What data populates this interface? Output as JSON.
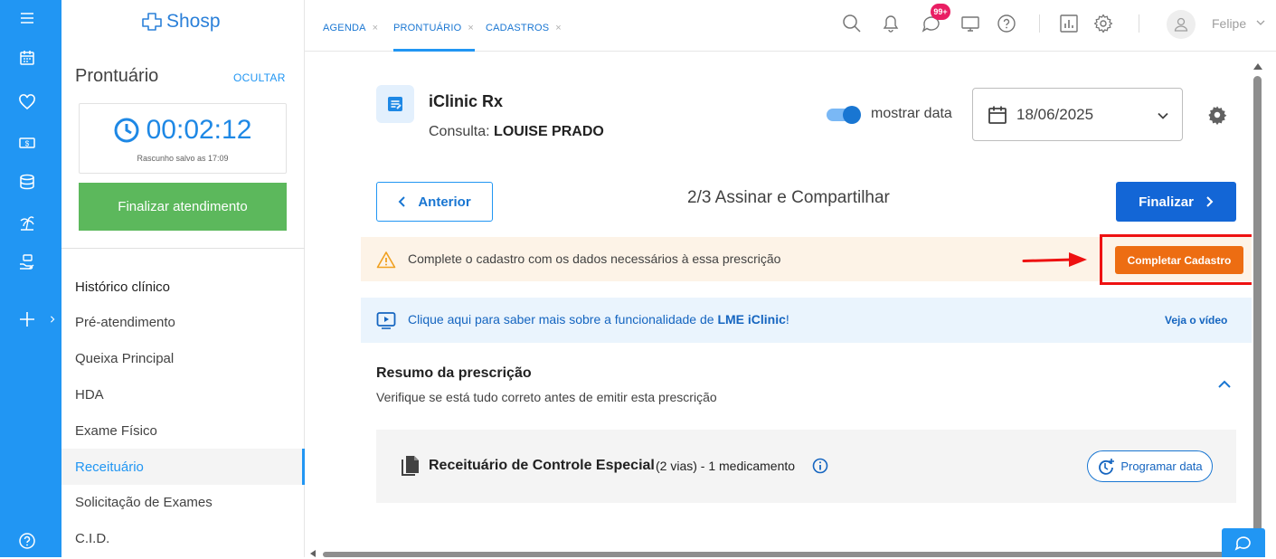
{
  "logo": {
    "text": "Shosp"
  },
  "rail": {
    "icons": [
      "menu-icon",
      "calendar-icon",
      "heart-icon",
      "money-icon",
      "database-icon",
      "palm-tree-icon",
      "hand-money-icon",
      "plus-icon",
      "help-circle-icon"
    ]
  },
  "sidebar": {
    "title": "Prontuário",
    "hide_label": "OCULTAR",
    "timer": "00:02:12",
    "draft_saved": "Rascunho salvo as 17:09",
    "finish_label": "Finalizar atendimento",
    "section_title": "Histórico clínico",
    "items": [
      {
        "label": "Pré-atendimento",
        "active": false
      },
      {
        "label": "Queixa Principal",
        "active": false
      },
      {
        "label": "HDA",
        "active": false
      },
      {
        "label": "Exame Físico",
        "active": false
      },
      {
        "label": "Receituário",
        "active": true
      },
      {
        "label": "Solicitação de Exames",
        "active": false
      },
      {
        "label": "C.I.D.",
        "active": false
      }
    ]
  },
  "tabs": [
    {
      "label": "AGENDA",
      "close": "×"
    },
    {
      "label": "PRONTUÁRIO",
      "close": "×"
    },
    {
      "label": "CADASTROS",
      "close": "×"
    }
  ],
  "topbar": {
    "notification_badge": "99+",
    "user_name": "Felipe"
  },
  "header": {
    "app_name": "iClinic Rx",
    "consult_prefix": "Consulta:",
    "patient_name": "LOUISE PRADO",
    "show_date_label": "mostrar data",
    "show_date_on": true,
    "date_value": "18/06/2025"
  },
  "stepper": {
    "prev_label": "Anterior",
    "step_title": "2/3 Assinar e Compartilhar",
    "next_label": "Finalizar"
  },
  "warning": {
    "text": "Complete o cadastro com os dados necessários à essa prescrição",
    "button_label": "Completar Cadastro"
  },
  "info": {
    "text_prefix": "Clique aqui para saber mais sobre a funcionalidade de ",
    "text_bold": "LME iClinic",
    "text_suffix": "!",
    "video_link": "Veja o vídeo"
  },
  "summary": {
    "title": "Resumo da prescrição",
    "subtitle": "Verifique se está tudo correto antes de emitir esta prescrição"
  },
  "prescription": {
    "title": "Receituário de Controle Especial",
    "meta": "(2 vias) - 1 medicamento",
    "schedule_label": "Programar data"
  },
  "colors": {
    "rail": "#2196f3",
    "primary": "#1366d6",
    "finish_green": "#5cb85c",
    "warning_orange": "#ed6d12",
    "highlight_red": "#ee1111"
  }
}
